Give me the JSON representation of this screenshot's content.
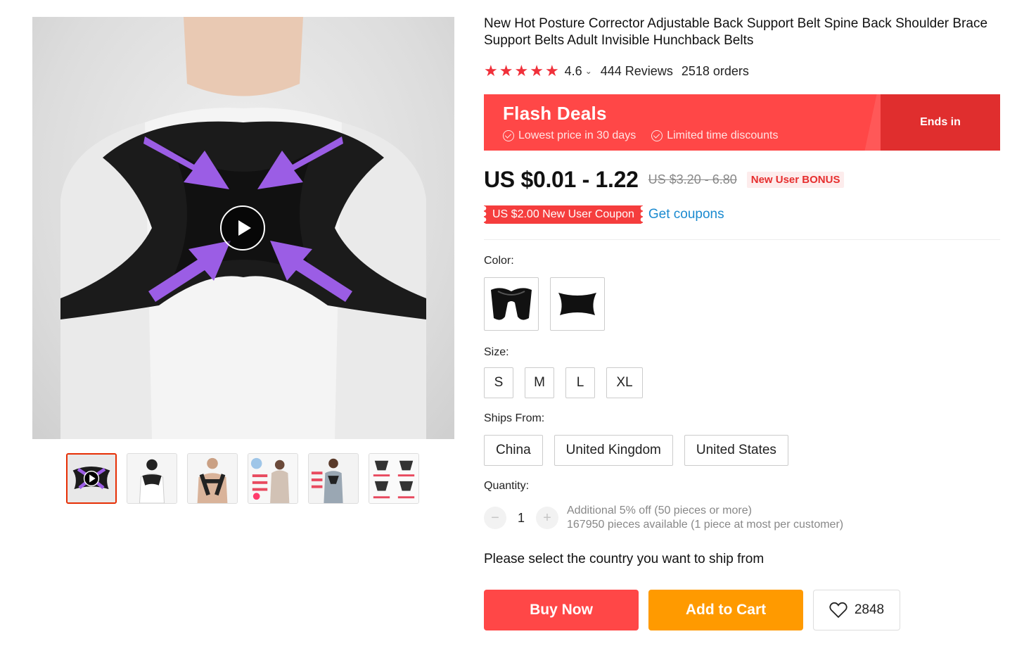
{
  "product": {
    "title": "New Hot Posture Corrector Adjustable Back Support Belt Spine Back Shoulder Brace Support Belts Adult Invisible Hunchback Belts",
    "rating": "4.6",
    "rating_chevron": "⌄",
    "reviews": "444 Reviews",
    "orders": "2518 orders",
    "star_color": "#f0303a"
  },
  "flash_deals": {
    "title": "Flash Deals",
    "features": [
      "Lowest price in 30 days",
      "Limited time discounts"
    ],
    "ends_label": "Ends in",
    "color": "#ff4747"
  },
  "pricing": {
    "price": "US $0.01 - 1.22",
    "original_price": "US $3.20 - 6.80",
    "bonus_badge": "New User BONUS",
    "coupon": "US $2.00 New User Coupon",
    "get_coupons": "Get coupons"
  },
  "color": {
    "label": "Color:",
    "options": [
      "black-full-brace",
      "black-x-brace"
    ]
  },
  "size": {
    "label": "Size:",
    "options": [
      "S",
      "M",
      "L",
      "XL"
    ]
  },
  "ships_from": {
    "label": "Ships From:",
    "options": [
      "China",
      "United Kingdom",
      "United States"
    ]
  },
  "quantity": {
    "label": "Quantity:",
    "minus": "−",
    "plus": "+",
    "value": "1",
    "note_discount": "Additional 5% off (50 pieces or more)",
    "note_available": "167950 pieces available (1 piece at most per customer)"
  },
  "ship_message": "Please select the country you want to ship from",
  "actions": {
    "buy_now": "Buy Now",
    "add_to_cart": "Add to Cart",
    "wishlist_count": "2848",
    "buy_color": "#ff4747",
    "cart_color": "#ff9a00"
  },
  "gallery": {
    "thumbnail_count": 6,
    "active_index": 0
  }
}
